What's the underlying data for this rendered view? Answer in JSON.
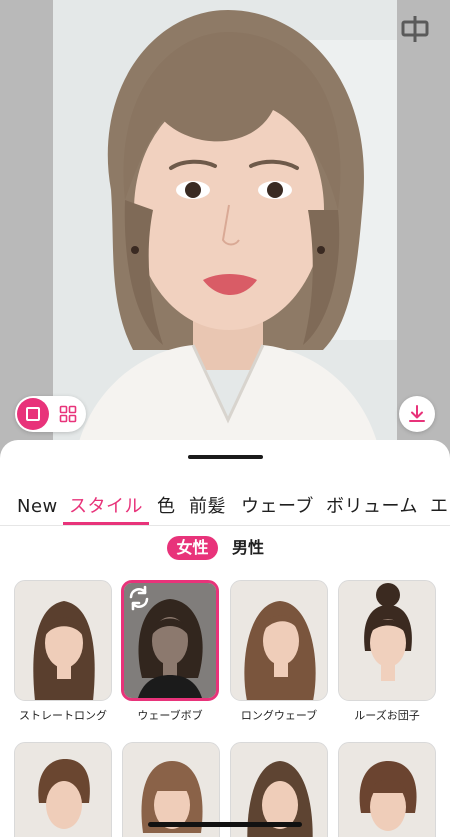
{
  "preview": {
    "download_icon": "download-icon",
    "language_icon": "chinese-char-icon",
    "language_glyph": "中",
    "view_modes": [
      "single-view-icon",
      "grid-view-icon"
    ]
  },
  "tabs": [
    {
      "label": "New"
    },
    {
      "label": "スタイル",
      "active": true
    },
    {
      "label": "色"
    },
    {
      "label": "前髪"
    },
    {
      "label": "ウェーブ"
    },
    {
      "label": "ボリューム"
    },
    {
      "label": "エ"
    }
  ],
  "gender": {
    "female": "女性",
    "male": "男性"
  },
  "styles": [
    {
      "label": "ストレートロング"
    },
    {
      "label": "ウェーブボブ",
      "selected": true
    },
    {
      "label": "ロングウェーブ"
    },
    {
      "label": "ルーズお団子"
    }
  ],
  "colors": {
    "accent": "#e8337a",
    "text": "#1f1f1f"
  }
}
